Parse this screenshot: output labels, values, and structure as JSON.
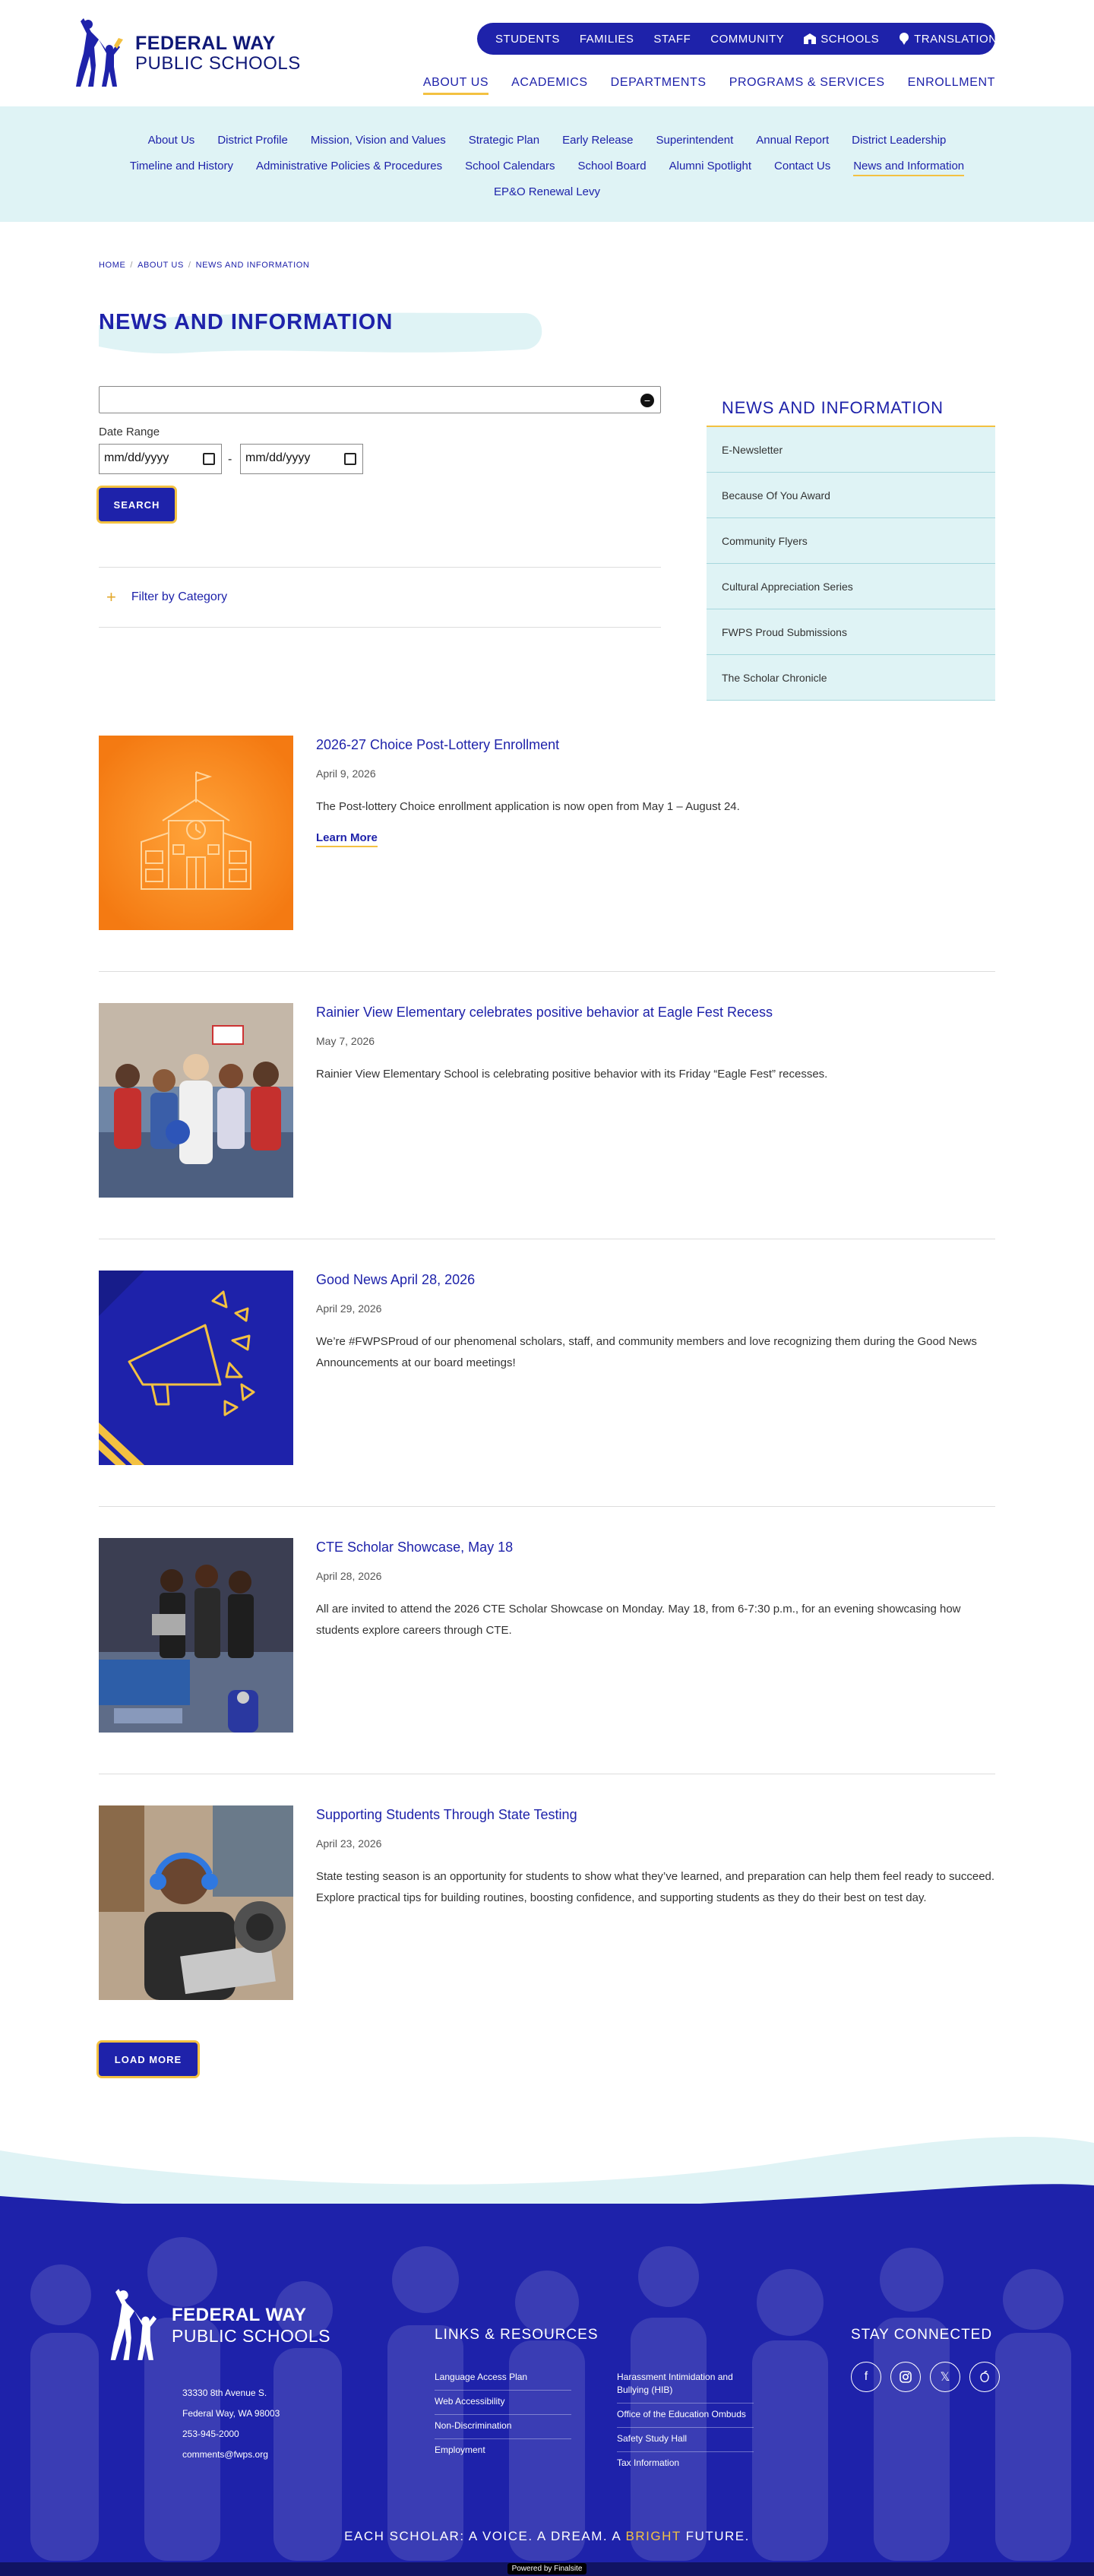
{
  "brand": {
    "name_line1": "FEDERAL WAY",
    "name_line2": "PUBLIC SCHOOLS",
    "primary": "#1e22aa",
    "accent": "#f3c141",
    "light": "#dff3f5"
  },
  "utility_nav": {
    "items": [
      "STUDENTS",
      "FAMILIES",
      "STAFF",
      "COMMUNITY"
    ],
    "schools": "SCHOOLS",
    "translation": "TRANSLATION",
    "search_icon": "search-icon"
  },
  "main_nav": {
    "items": [
      "ABOUT US",
      "ACADEMICS",
      "DEPARTMENTS",
      "PROGRAMS & SERVICES",
      "ENROLLMENT"
    ]
  },
  "sub_nav": {
    "row1": [
      "About Us",
      "District Profile",
      "Mission, Vision and Values",
      "Strategic Plan",
      "Early Release",
      "Superintendent",
      "Annual Report",
      "District Leadership"
    ],
    "row2": [
      "Timeline and History",
      "Administrative Policies & Procedures",
      "School Calendars",
      "School Board",
      "Alumni Spotlight",
      "Contact Us",
      "News and Information"
    ],
    "row3": [
      "EP&O Renewal Levy"
    ]
  },
  "breadcrumb": [
    "HOME",
    "ABOUT US",
    "NEWS AND INFORMATION"
  ],
  "page_title": "NEWS AND INFORMATION",
  "search": {
    "value": "",
    "date_label": "Date Range",
    "date_placeholder": "mm/dd/yyyy",
    "date_sep": "-",
    "button": "SEARCH",
    "filter_label": "Filter by Category"
  },
  "sidebar": {
    "title": "NEWS AND INFORMATION",
    "items": [
      "E-Newsletter",
      "Because Of You Award",
      "Community Flyers",
      "Cultural Appreciation Series",
      "FWPS Proud Submissions",
      "The Scholar Chronicle"
    ]
  },
  "news": [
    {
      "title": "2026-27 Choice Post-Lottery Enrollment",
      "date": "April 9, 2026",
      "excerpt": "The Post-lottery Choice enrollment application is now open from May 1 – August 24.",
      "more": "Learn More"
    },
    {
      "title": "Rainier View Elementary celebrates positive behavior at Eagle Fest Recess",
      "date": "May 7, 2026",
      "excerpt": "Rainier View Elementary School is celebrating positive behavior with its Friday “Eagle Fest” recesses."
    },
    {
      "title": "Good News April 28, 2026",
      "date": "April 29, 2026",
      "excerpt": "We’re #FWPSProud of our phenomenal scholars, staff, and community members and love recognizing them during the Good News Announcements at our board meetings!"
    },
    {
      "title": "CTE Scholar Showcase, May 18",
      "date": "April 28, 2026",
      "excerpt": "All are invited to attend the 2026 CTE Scholar Showcase on Monday. May 18, from 6-7:30 p.m., for an evening showcasing how students explore careers through CTE."
    },
    {
      "title": "Supporting Students Through State Testing",
      "date": "April 23, 2026",
      "excerpt": "State testing season is an opportunity for students to show what they’ve learned, and preparation can help them feel ready to succeed. Explore practical tips for building routines, boosting confidence, and supporting students as they do their best on test day."
    }
  ],
  "load_more": "LOAD MORE",
  "footer": {
    "address1": "33330 8th Avenue S.",
    "address2": "Federal Way, WA  98003",
    "phone": "253-945-2000",
    "email": "comments@fwps.org",
    "links_title": "LINKS & RESOURCES",
    "links_col1": [
      "Language Access Plan",
      "Web Accessibility",
      "Non-Discrimination",
      "Employment"
    ],
    "links_col2": [
      "Harassment Intimidation and Bullying (HIB)",
      "Office of the Education Ombuds",
      "Safety Study Hall",
      "Tax Information"
    ],
    "stay_title": "STAY CONNECTED",
    "tagline_a": "EACH SCHOLAR: A VOICE. A DREAM. A ",
    "tagline_b": "BRIGHT",
    "tagline_c": " FUTURE.",
    "powered": "Powered by Finalsite"
  }
}
